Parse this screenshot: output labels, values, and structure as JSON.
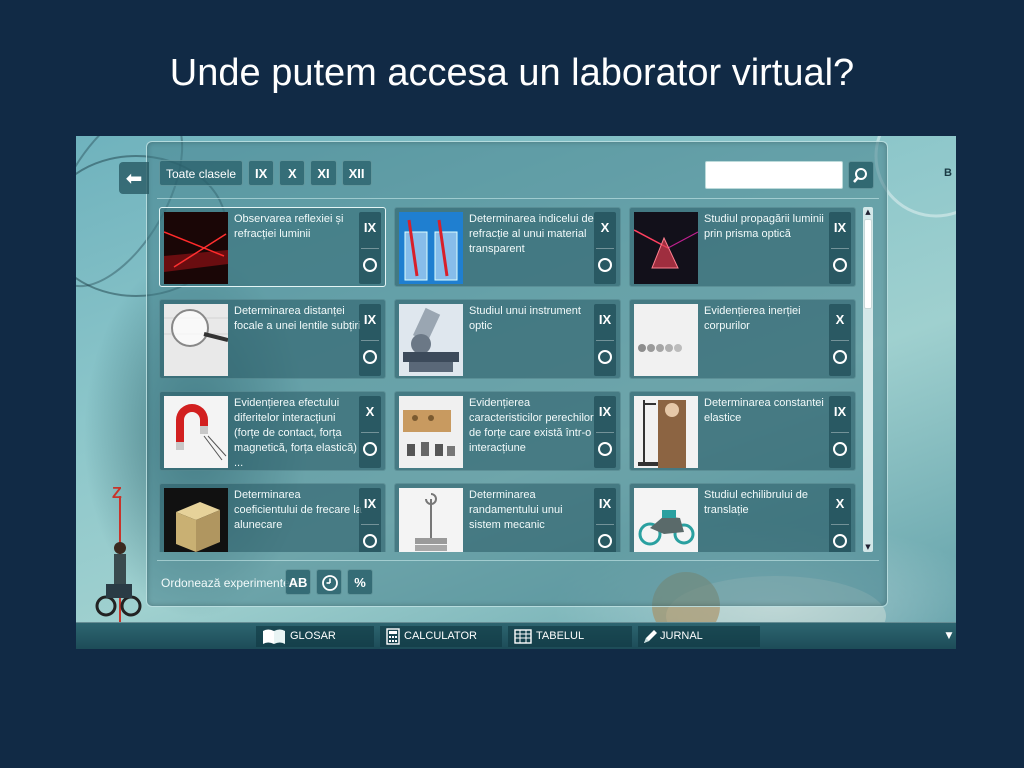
{
  "slide": {
    "title": "Unde putem accesa un laborator virtual?"
  },
  "filters": {
    "all_label": "Toate clasele",
    "grades": [
      "IX",
      "X",
      "XI",
      "XII"
    ]
  },
  "search": {
    "value": "",
    "placeholder": ""
  },
  "experiments": [
    {
      "title": "Observarea reflexiei și refracției luminii",
      "grade": "IX",
      "icon": "laser-reflection-image"
    },
    {
      "title": "Determinarea indicelui de refracție al unui material transparent",
      "grade": "X",
      "icon": "water-glasses-straws-image"
    },
    {
      "title": "Studiul propagării luminii prin prisma optică",
      "grade": "IX",
      "icon": "prism-image"
    },
    {
      "title": "Determinarea distanței focale a unei lentile subțiri",
      "grade": "IX",
      "icon": "magnifying-lens-image"
    },
    {
      "title": "Studiul unui instrument optic",
      "grade": "IX",
      "icon": "microscope-image"
    },
    {
      "title": "Evidențierea inerției corpurilor",
      "grade": "X",
      "icon": "newton-cradle-image"
    },
    {
      "title": "Evidențierea efectului diferitelor interacțiuni (forțe de contact, forța magnetică, forța elastică) ...",
      "grade": "X",
      "icon": "horseshoe-magnet-image"
    },
    {
      "title": "Evidențierea caracteristicilor perechilor de forțe care există într-o interacțiune",
      "grade": "IX",
      "icon": "wooden-block-weights-image"
    },
    {
      "title": "Determinarea constantei elastice",
      "grade": "IX",
      "icon": "spring-stand-image"
    },
    {
      "title": "Determinarea coeficientului de frecare la alunecare",
      "grade": "IX",
      "icon": "wooden-cube-image"
    },
    {
      "title": "Determinarea randamentului unui sistem mecanic",
      "grade": "IX",
      "icon": "hook-weight-image"
    },
    {
      "title": "Studiul echilibrului de translație",
      "grade": "X",
      "icon": "motorcycle-model-image"
    }
  ],
  "sort": {
    "label": "Ordonează experimentele:",
    "alpha_label": "AB",
    "time_label": "",
    "percent_label": "%"
  },
  "bottom_bar": {
    "glossary": "GLOSAR",
    "calculator": "CALCULATOR",
    "periodic_table": "TABELUL PERIODIC",
    "journal": "JURNAL"
  },
  "decor": {
    "axis_z": "Z",
    "axis_b": "B"
  },
  "colors": {
    "slide_background": "#112a45",
    "panel": "#46828c",
    "accent_white": "#ffffff"
  }
}
